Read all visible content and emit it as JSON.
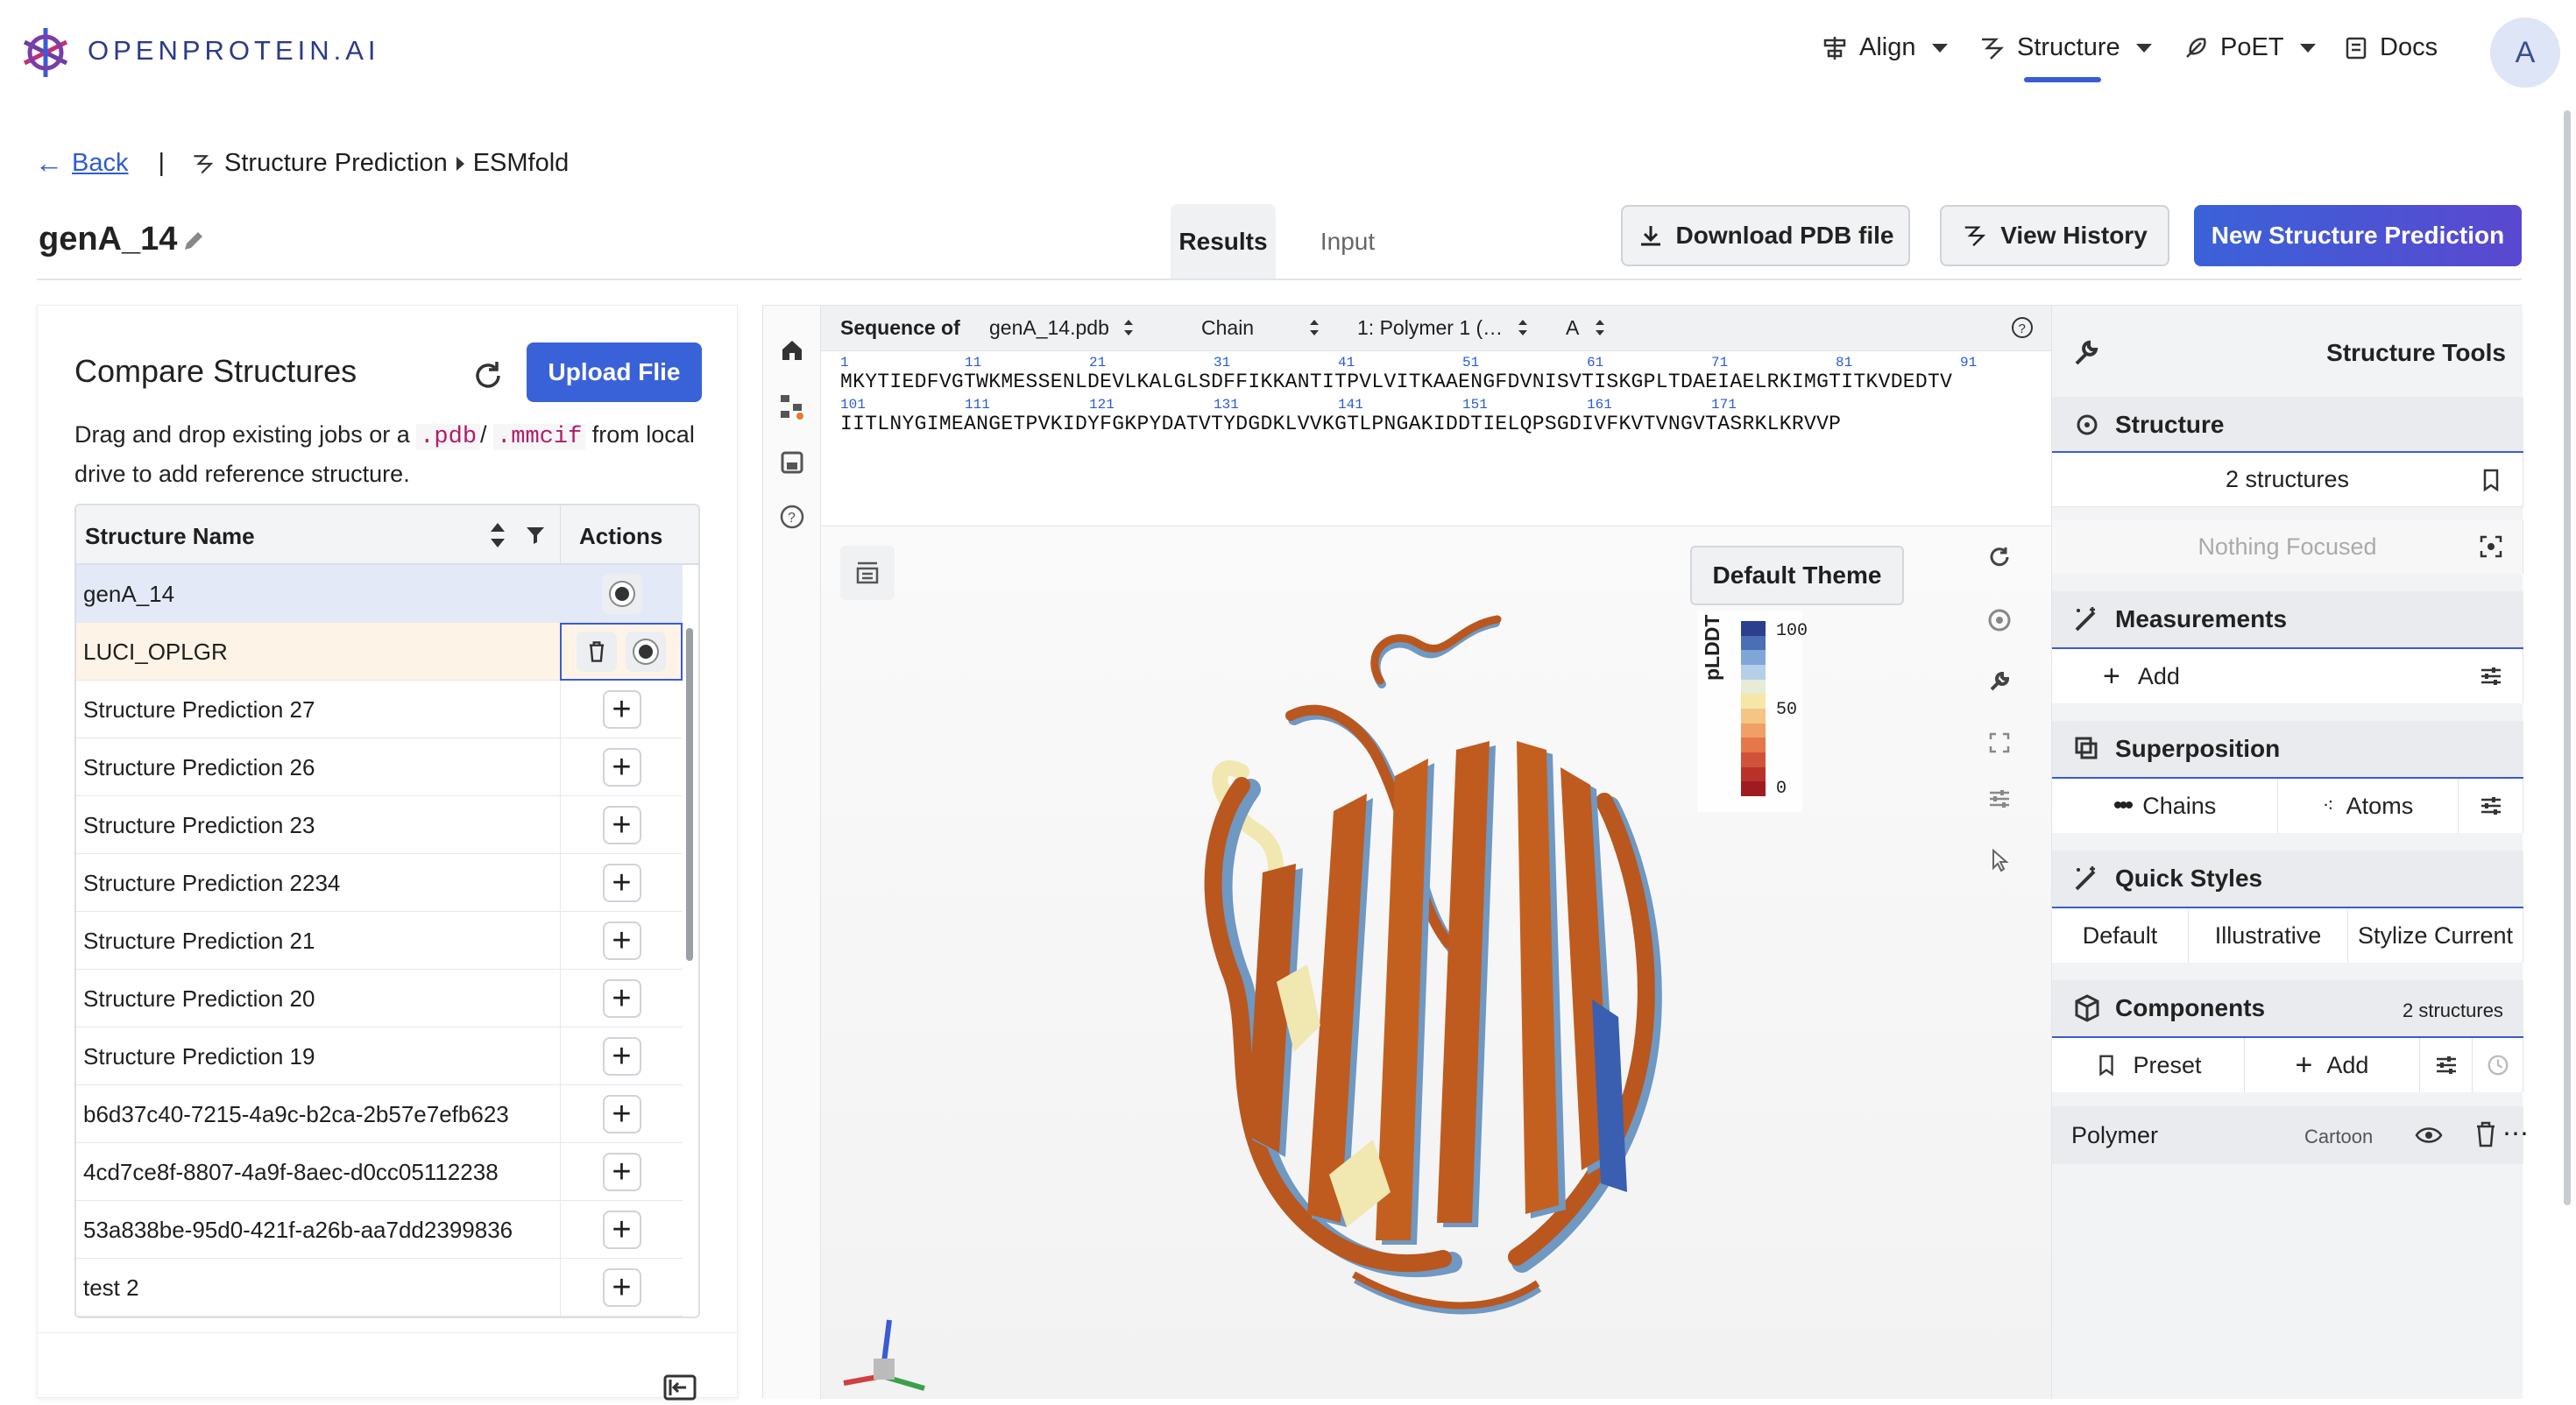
{
  "brand": {
    "name": "OPENPROTEIN.AI"
  },
  "nav": {
    "align": "Align",
    "structure": "Structure",
    "poet": "PoET",
    "docs": "Docs",
    "avatar": "A"
  },
  "breadcrumb": {
    "back": "Back",
    "separator": "|",
    "section": "Structure Prediction",
    "page": "ESMfold"
  },
  "header": {
    "job_title": "genA_14",
    "tabs": [
      "Results",
      "Input"
    ],
    "download_label": "Download PDB file",
    "history_label": "View History",
    "new_label": "New Structure Prediction"
  },
  "compare": {
    "title": "Compare Structures",
    "upload_label": "Upload Flie",
    "desc_prefix": "Drag and drop existing jobs or a ",
    "ext_pdb": ".pdb",
    "desc_slash": "/ ",
    "ext_mmcif": ".mmcif",
    "desc_suffix": " from local drive to add reference structure.",
    "col_name": "Structure Name",
    "col_actions": "Actions",
    "rows": [
      "genA_14",
      "LUCI_OPLGR",
      "Structure Prediction 27",
      "Structure Prediction 26",
      "Structure Prediction 23",
      "Structure Prediction 2234",
      "Structure Prediction 21",
      "Structure Prediction 20",
      "Structure Prediction 19",
      "b6d37c40-7215-4a9c-b2ca-2b57e7efb623",
      "4cd7ce8f-8807-4a9f-8aec-d0cc05112238",
      "53a838be-95d0-421f-a26b-aa7dd2399836",
      "test 2"
    ]
  },
  "sequence": {
    "label": "Sequence of",
    "file": "genA_14.pdb",
    "chain_label": "Chain",
    "polymer": "1: Polymer 1 (…",
    "chain": "A",
    "line1": "MKYTIEDFVGTWKMESSENLDEVLKALGLSDFFIKKANTITPVLVITKAAENGFDVNISVTISKGPLTDAEIAELRKIMGTITKVDEDTV",
    "line2": "IITLNYGIMEANGETPVKIDYFGKPYDATVTYDGDKLVVKGTLPNGAKIDDTIELQPSGDIVFKVTVNGVTASRKLKRVVP",
    "nums1": [
      "1",
      "11",
      "21",
      "31",
      "41",
      "51",
      "61",
      "71",
      "81",
      "91"
    ],
    "nums2": [
      "101",
      "111",
      "121",
      "131",
      "141",
      "151",
      "161",
      "171"
    ]
  },
  "viewer": {
    "theme_label": "Default Theme",
    "legend_title": "pLDDT",
    "legend_ticks": [
      "100",
      "50",
      "0"
    ],
    "legend_colors": [
      "#2c3e8f",
      "#4a6fb5",
      "#7fa6d6",
      "#b6cfe8",
      "#e8ecd6",
      "#f6e6a8",
      "#f5c585",
      "#f0a066",
      "#e4784a",
      "#d0523a",
      "#b83228",
      "#9e1b22"
    ]
  },
  "tools": {
    "title": "Structure Tools",
    "structure": "Structure",
    "structures_count": "2 structures",
    "focus": "Nothing Focused",
    "measurements": "Measurements",
    "add": "Add",
    "superposition": "Superposition",
    "chains": "Chains",
    "atoms": "Atoms",
    "quick_styles": "Quick Styles",
    "style_default": "Default",
    "style_illustrative": "Illustrative",
    "style_current": "Stylize Current",
    "components": "Components",
    "components_count": "2 structures",
    "preset": "Preset",
    "add2": "Add",
    "polymer": "Polymer",
    "cartoon": "Cartoon"
  }
}
